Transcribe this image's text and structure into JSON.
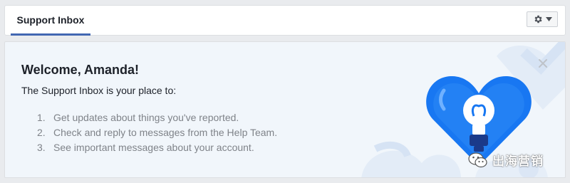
{
  "header": {
    "tab_label": "Support Inbox",
    "settings_icon": "gear-icon",
    "dropdown_icon": "caret-down-icon"
  },
  "welcome": {
    "title": "Welcome, Amanda!",
    "intro": "The Support Inbox is your place to:",
    "items": [
      {
        "num": "1.",
        "text": "Get updates about things you've reported."
      },
      {
        "num": "2.",
        "text": "Check and reply to messages from the Help Team."
      },
      {
        "num": "3.",
        "text": "See important messages about your account."
      }
    ],
    "close_icon": "close-icon",
    "illustration": "heart-lightbulb-illustration"
  },
  "watermark": {
    "text": "出海营销",
    "icon": "wechat-icon"
  },
  "colors": {
    "accent": "#4267b2",
    "panel_bg": "#f1f6fb",
    "heart_blue": "#1877f2"
  }
}
